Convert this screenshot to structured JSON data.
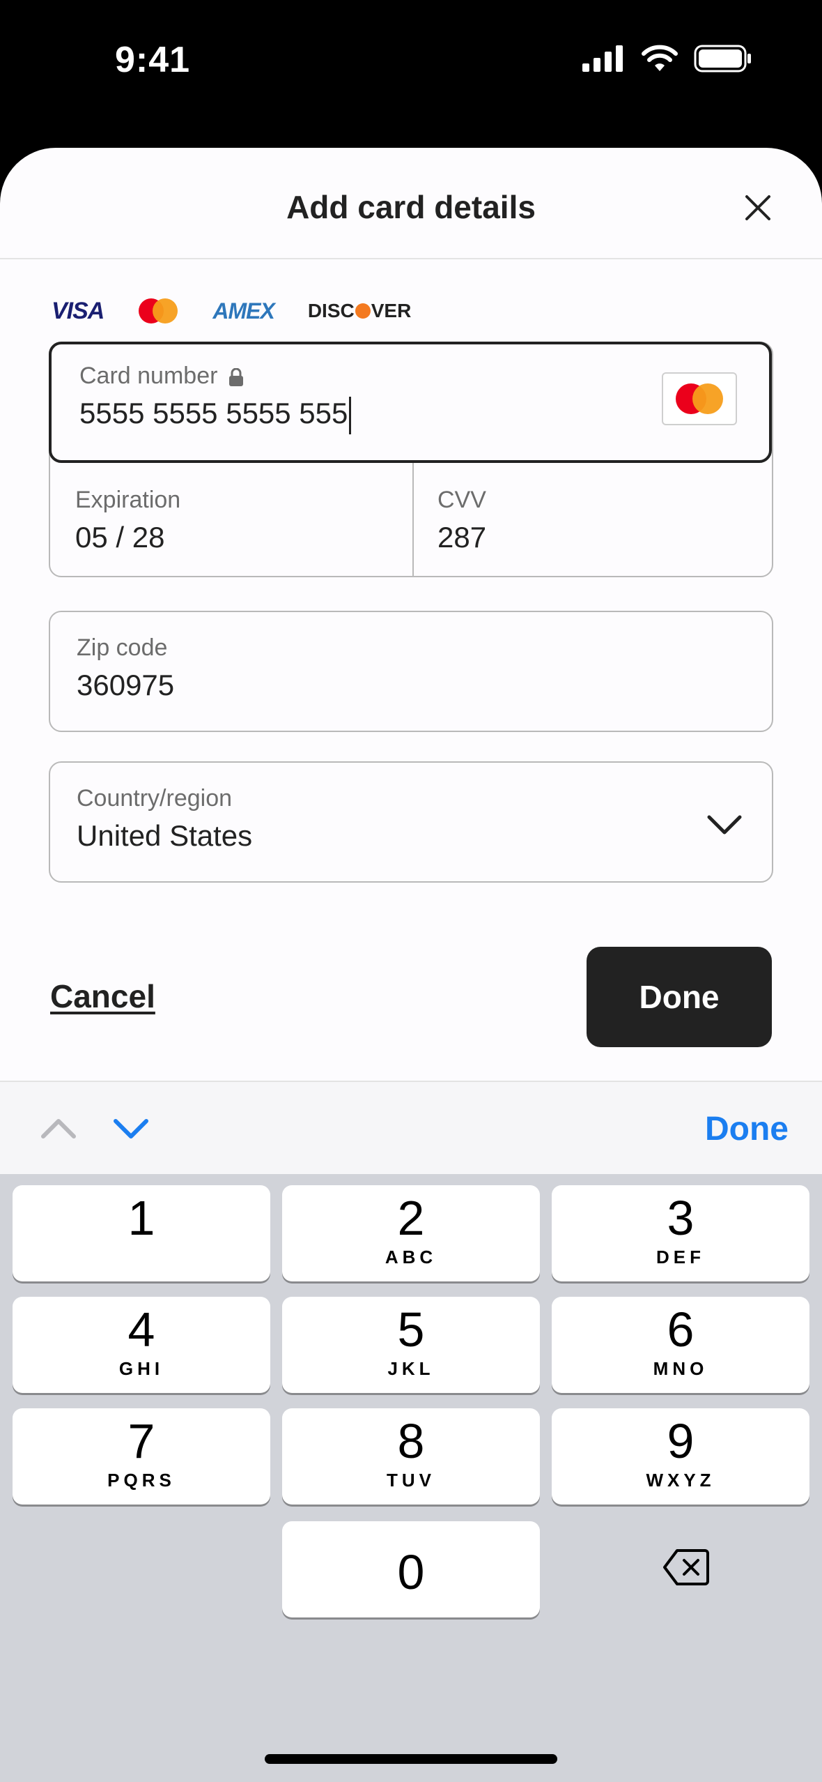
{
  "status": {
    "time": "9:41"
  },
  "sheet": {
    "title": "Add card details"
  },
  "brands": {
    "visa": "VISA",
    "amex": "AMEX",
    "discover_pre": "DISC",
    "discover_post": "VER"
  },
  "card": {
    "number_label": "Card number",
    "number_value": "5555 5555 5555 555",
    "expiration_label": "Expiration",
    "expiration_value": "05 / 28",
    "cvv_label": "CVV",
    "cvv_value": "287"
  },
  "zip": {
    "label": "Zip code",
    "value": "360975"
  },
  "country": {
    "label": "Country/region",
    "value": "United States"
  },
  "actions": {
    "cancel": "Cancel",
    "done": "Done"
  },
  "accessory": {
    "done": "Done"
  },
  "keypad": [
    {
      "num": "1",
      "letters": ""
    },
    {
      "num": "2",
      "letters": "ABC"
    },
    {
      "num": "3",
      "letters": "DEF"
    },
    {
      "num": "4",
      "letters": "GHI"
    },
    {
      "num": "5",
      "letters": "JKL"
    },
    {
      "num": "6",
      "letters": "MNO"
    },
    {
      "num": "7",
      "letters": "PQRS"
    },
    {
      "num": "8",
      "letters": "TUV"
    },
    {
      "num": "9",
      "letters": "WXYZ"
    },
    {
      "num": "0",
      "letters": ""
    }
  ],
  "colors": {
    "accent": "#1b7ef0",
    "primary_button": "#222222",
    "mastercard_red": "#eb001b",
    "mastercard_orange": "#f79e1b"
  }
}
